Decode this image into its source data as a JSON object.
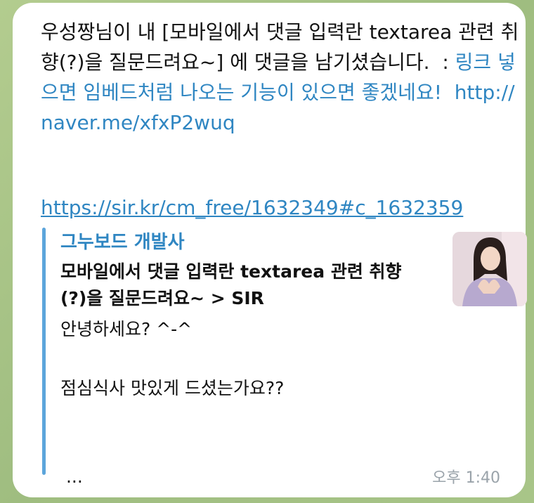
{
  "message": {
    "line1": "우성짱님이 내 [모바일에서 댓글 입력란 textarea 관련 취향(?)을 질문드려요~] 에 댓글을 남기셨습니다.  : ",
    "highlight": "링크 넣으면 임베드처럼 나오는 기능이 있으면 좋겠네요!",
    "url_short": "  http://naver.me/xfxP2wuq",
    "url_full": "https://sir.kr/cm_free/1632349#c_1632359"
  },
  "preview": {
    "site": "그누보드 개발사",
    "title": "모바일에서 댓글 입력란 textarea 관련 취향(?)을 질문드려요~ > SIR",
    "description": "안녕하세요? ^-^\n\n점심식사 맛있게 드셨는가요??\n\n\n ...",
    "thumbnail_icon": "profile-photo-icon"
  },
  "time": "오후 1:40",
  "colors": {
    "link": "#2f86c2",
    "accent_bar": "#5ca5db",
    "background": "#a9c48a"
  }
}
